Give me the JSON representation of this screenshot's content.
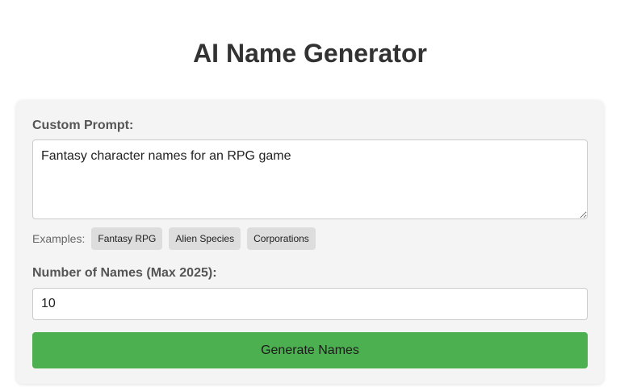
{
  "page": {
    "title": "AI Name Generator"
  },
  "form": {
    "prompt_label": "Custom Prompt:",
    "prompt_value": "Fantasy character names for an RPG game",
    "examples_label": "Examples:",
    "examples": [
      "Fantasy RPG",
      "Alien Species",
      "Corporations"
    ],
    "count_label": "Number of Names (Max 2025):",
    "count_value": "10",
    "generate_label": "Generate Names"
  },
  "colors": {
    "accent": "#4caf50",
    "card_bg": "#f4f4f4",
    "chip_bg": "#dddddd"
  }
}
